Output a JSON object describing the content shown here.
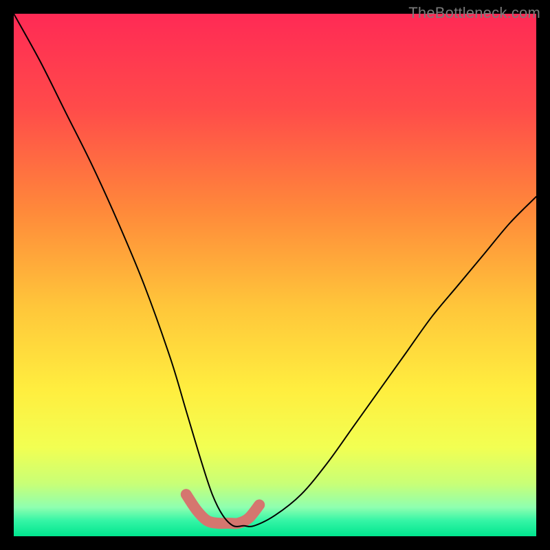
{
  "watermark": "TheBottleneck.com",
  "colors": {
    "frame": "#000000",
    "curve": "#000000",
    "highlight": "#d5766f",
    "watermark": "#7a7a7a"
  },
  "gradient_stops": [
    {
      "offset": 0.0,
      "color": "#ff2a55"
    },
    {
      "offset": 0.18,
      "color": "#ff4b4a"
    },
    {
      "offset": 0.38,
      "color": "#ff8a3a"
    },
    {
      "offset": 0.56,
      "color": "#ffc63a"
    },
    {
      "offset": 0.72,
      "color": "#ffee3f"
    },
    {
      "offset": 0.83,
      "color": "#f2ff52"
    },
    {
      "offset": 0.9,
      "color": "#c8ff77"
    },
    {
      "offset": 0.945,
      "color": "#8effb0"
    },
    {
      "offset": 0.97,
      "color": "#35f5a6"
    },
    {
      "offset": 1.0,
      "color": "#00e58e"
    }
  ],
  "chart_data": {
    "type": "line",
    "title": "",
    "xlabel": "",
    "ylabel": "",
    "xlim": [
      0,
      100
    ],
    "ylim": [
      0,
      100
    ],
    "grid": false,
    "legend": false,
    "series": [
      {
        "name": "bottleneck-curve",
        "x": [
          0,
          5,
          10,
          15,
          20,
          25,
          30,
          33,
          36,
          38,
          40,
          42,
          44,
          46,
          50,
          55,
          60,
          65,
          70,
          75,
          80,
          85,
          90,
          95,
          100
        ],
        "y": [
          100,
          91,
          81,
          71,
          60,
          48,
          34,
          24,
          14,
          8,
          4,
          2,
          2,
          2,
          4,
          8,
          14,
          21,
          28,
          35,
          42,
          48,
          54,
          60,
          65
        ]
      }
    ],
    "highlight_segment": {
      "name": "valley-floor",
      "x": [
        33,
        35,
        37,
        39,
        41,
        43,
        45,
        47
      ],
      "y": [
        8,
        5,
        3,
        2.5,
        2.5,
        2.5,
        3.5,
        6
      ]
    }
  }
}
